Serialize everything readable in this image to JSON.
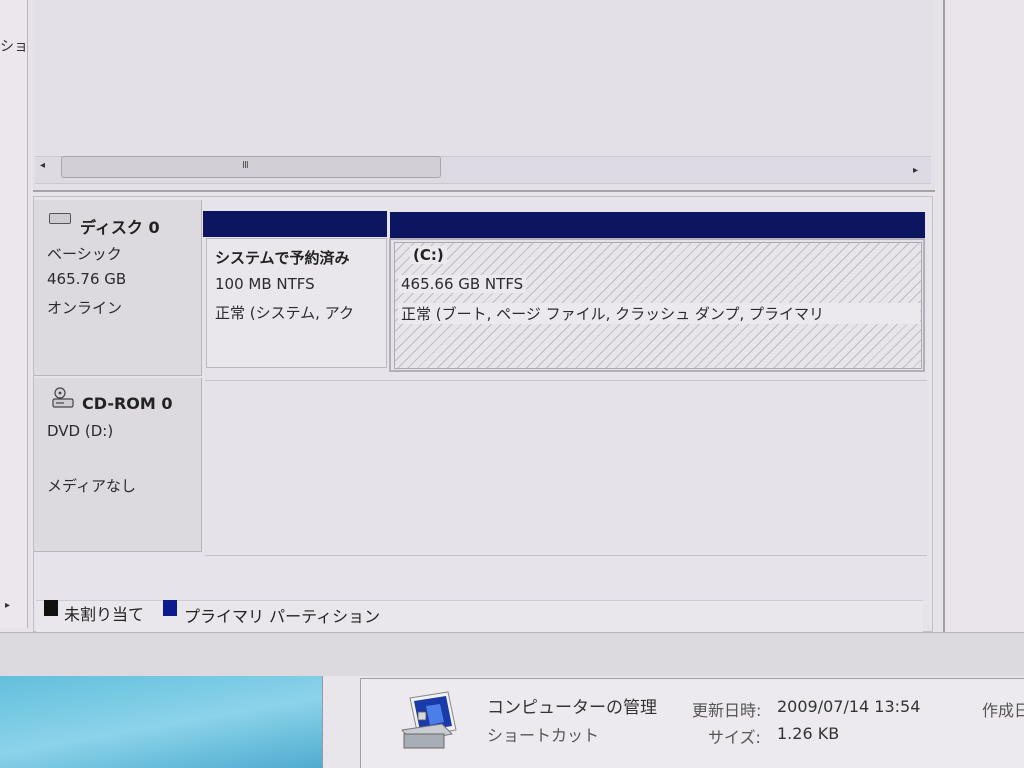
{
  "window": {
    "left_text": "ショ"
  },
  "scrollbar": {
    "left_arrow": "◂",
    "right_arrow": "▸",
    "thumb_grip": "III"
  },
  "disks": [
    {
      "title": "ディスク 0",
      "type": "ベーシック",
      "size": "465.76 GB",
      "status": "オンライン"
    },
    {
      "title": "CD-ROM 0",
      "type": "DVD (D:)",
      "status": "メディアなし"
    }
  ],
  "partitions": [
    {
      "name": "システムで予約済み",
      "size": "100 MB NTFS",
      "status": "正常 (システム, アク"
    },
    {
      "name": "(C:)",
      "size": "465.66 GB NTFS",
      "status": "正常 (ブート, ページ ファイル, クラッシュ ダンプ, プライマリ"
    }
  ],
  "legend": [
    {
      "label": "未割り当て",
      "color": "#111111"
    },
    {
      "label": "プライマリ パーティション",
      "color": "#0b1a8c"
    }
  ],
  "details": {
    "name": "コンピューターの管理",
    "type": "ショートカット",
    "modified_label": "更新日時:",
    "modified_value": "2009/07/14 13:54",
    "size_label": "サイズ:",
    "size_value": "1.26 KB",
    "created_label": "作成日"
  },
  "colors": {
    "partition_header": "#0b1560",
    "background": "#e7e3e9"
  },
  "icons": {
    "disk": "hard-disk-icon",
    "cdrom": "cd-drive-icon",
    "app": "computer-management-icon"
  }
}
